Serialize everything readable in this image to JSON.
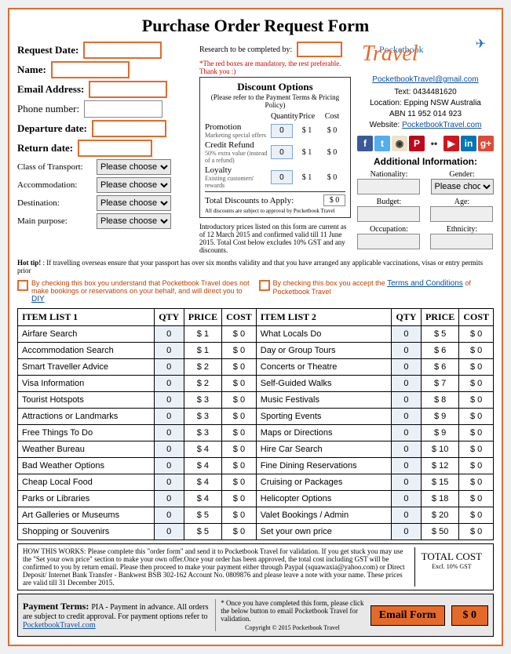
{
  "title": "Purchase Order Request Form",
  "fields": {
    "request_date": "Request Date:",
    "research_by": "Research to be completed by:",
    "name": "Name:",
    "email": "Email Address:",
    "phone": "Phone number:",
    "departure": "Departure date:",
    "return": "Return date:",
    "class_transport": "Class of Transport:",
    "accommodation": "Accommodation:",
    "destination": "Destination:",
    "main_purpose": "Main purpose:",
    "select_default": "Please choose..."
  },
  "mandatory_note": "*The red boxes are mandatory, the rest preferable. Thank you :)",
  "discount": {
    "title": "Discount Options",
    "sub": "(Please refer to the Payment Terms & Pricing Policy)",
    "cols": [
      "Quantity",
      "Price",
      "Cost"
    ],
    "rows": [
      {
        "name": "Promotion",
        "note": "Marketing special offers",
        "qty": 0,
        "price": "$ 1",
        "cost": "$ 0"
      },
      {
        "name": "Credit Refund",
        "note": "50% extra value (instead of a refund)",
        "qty": 0,
        "price": "$ 1",
        "cost": "$ 0"
      },
      {
        "name": "Loyalty",
        "note": "Existing customers' rewards",
        "qty": 0,
        "price": "$ 1",
        "cost": "$ 0"
      }
    ],
    "total_label": "Total Discounts to Apply:",
    "total_value": "$ 0",
    "total_note": "All discounts are subject to approval by Pocketbook Travel"
  },
  "brand": {
    "top": "Pocketbook",
    "big": "Travel",
    "email": "PocketbookTravel@gmail.com",
    "text": "Text: 0434481620",
    "location": "Location: Epping NSW Australia",
    "abn": "ABN 11 952 014 923",
    "website_label": "Website: ",
    "website": "PocketbookTravel.com"
  },
  "icons": [
    {
      "name": "facebook-icon",
      "bg": "#3b5998",
      "label": "f"
    },
    {
      "name": "twitter-icon",
      "bg": "#55acee",
      "label": "t"
    },
    {
      "name": "instagram-icon",
      "bg": "#efe2c9",
      "label": "◉"
    },
    {
      "name": "pinterest-icon",
      "bg": "#bd081c",
      "label": "P"
    },
    {
      "name": "flickr-icon",
      "bg": "#ffffff",
      "label": "••"
    },
    {
      "name": "youtube-icon",
      "bg": "#cc181e",
      "label": "▶"
    },
    {
      "name": "linkedin-icon",
      "bg": "#0077b5",
      "label": "in"
    },
    {
      "name": "google-icon",
      "bg": "#dd4b39",
      "label": "g+"
    }
  ],
  "additional": {
    "title": "Additional Information:",
    "labels": [
      "Nationality:",
      "Gender:",
      "Budget:",
      "Age:",
      "Occupation:",
      "Ethnicity:"
    ]
  },
  "intro_note": "Introductory prices listed on this form are current as of 12 March 2015 and confirmed valid till 11 June 2015. Total Cost below excludes 10% GST and any discounts.",
  "hottip": "Hot tip! : If travelling overseas ensure that your passport has over six months validity and that you have arranged any applicable vaccinations, visas or entry permits prior",
  "check1a": "By checking this box you understand that Pocketbook Travel does not make bookings or reservations on your behalf, and will direct you to ",
  "check1b": "DIY",
  "check2a": "By checking this box you accept the ",
  "check2b": "Terms and Conditions",
  "check2c": " of Pocketbook Travel",
  "headers": [
    "ITEM LIST 1",
    "QTY",
    "PRICE",
    "COST",
    "ITEM LIST 2",
    "QTY",
    "PRICE",
    "COST"
  ],
  "rows": [
    {
      "l": "Airfare Search",
      "lq": 0,
      "lp": "$ 1",
      "lc": "$ 0",
      "r": "What Locals Do",
      "rq": 0,
      "rp": "$ 5",
      "rc": "$ 0"
    },
    {
      "l": "Accommodation Search",
      "lq": 0,
      "lp": "$ 1",
      "lc": "$ 0",
      "r": "Day or Group Tours",
      "rq": 0,
      "rp": "$ 6",
      "rc": "$ 0"
    },
    {
      "l": "Smart Traveller Advice",
      "lq": 0,
      "lp": "$ 2",
      "lc": "$ 0",
      "r": "Concerts or Theatre",
      "rq": 0,
      "rp": "$ 6",
      "rc": "$ 0"
    },
    {
      "l": "Visa Information",
      "lq": 0,
      "lp": "$ 2",
      "lc": "$ 0",
      "r": "Self-Guided Walks",
      "rq": 0,
      "rp": "$ 7",
      "rc": "$ 0"
    },
    {
      "l": "Tourist Hotspots",
      "lq": 0,
      "lp": "$ 3",
      "lc": "$ 0",
      "r": "Music Festivals",
      "rq": 0,
      "rp": "$ 8",
      "rc": "$ 0"
    },
    {
      "l": "Attractions or Landmarks",
      "lq": 0,
      "lp": "$ 3",
      "lc": "$ 0",
      "r": "Sporting Events",
      "rq": 0,
      "rp": "$ 9",
      "rc": "$ 0"
    },
    {
      "l": "Free Things To Do",
      "lq": 0,
      "lp": "$ 3",
      "lc": "$ 0",
      "r": "Maps or Directions",
      "rq": 0,
      "rp": "$ 9",
      "rc": "$ 0"
    },
    {
      "l": "Weather Bureau",
      "lq": 0,
      "lp": "$ 4",
      "lc": "$ 0",
      "r": "Hire Car Search",
      "rq": 0,
      "rp": "$ 10",
      "rc": "$ 0"
    },
    {
      "l": "Bad Weather Options",
      "lq": 0,
      "lp": "$ 4",
      "lc": "$ 0",
      "r": "Fine Dining Reservations",
      "rq": 0,
      "rp": "$ 12",
      "rc": "$ 0"
    },
    {
      "l": "Cheap Local Food",
      "lq": 0,
      "lp": "$ 4",
      "lc": "$ 0",
      "r": "Cruising or Packages",
      "rq": 0,
      "rp": "$ 15",
      "rc": "$ 0"
    },
    {
      "l": "Parks or Libraries",
      "lq": 0,
      "lp": "$ 4",
      "lc": "$ 0",
      "r": "Helicopter Options",
      "rq": 0,
      "rp": "$ 18",
      "rc": "$ 0"
    },
    {
      "l": "Art Galleries or Museums",
      "lq": 0,
      "lp": "$ 5",
      "lc": "$ 0",
      "r": "Valet Bookings / Admin",
      "rq": 0,
      "rp": "$ 20",
      "rc": "$ 0"
    },
    {
      "l": "Shopping or Souvenirs",
      "lq": 0,
      "lp": "$ 5",
      "lc": "$ 0",
      "r": "Set your own price",
      "rq": 0,
      "rp": "$ 50",
      "rc": "$ 0"
    }
  ],
  "how": "HOW THIS WORKS: Please complete this \"order form\" and send it to Pocketbook Travel for validation. If you get stuck you may use the \"Set your own price\" section to make your own offer.Once your order has been approved, the total cost including GST will be confirmed to you by return email. Please then proceed to make your payment either through Paypal (squawaxia@yahoo.com) or Direct Deposit/ Internet Bank Transfer - Bankwest BSB 302-162 Account No. 0809876 and please leave a note with your name. These prices are valid till 31 December 2015.",
  "totalcost": {
    "big": "TOTAL COST",
    "small": "Excl. 10% GST"
  },
  "pay": {
    "title": "Payment Terms: ",
    "big": "PIA - Payment in advance.",
    "rest": "  All orders are subject to credit approval. For payment options refer to ",
    "link": "PocketbookTravel.com",
    "note": "* Once you have completed this form, please click the below button to email Pocketbook Travel for validation.",
    "btn": "Email Form",
    "amt": "$ 0",
    "copyright": "Copyright © 2015 Pocketbook Travel"
  }
}
